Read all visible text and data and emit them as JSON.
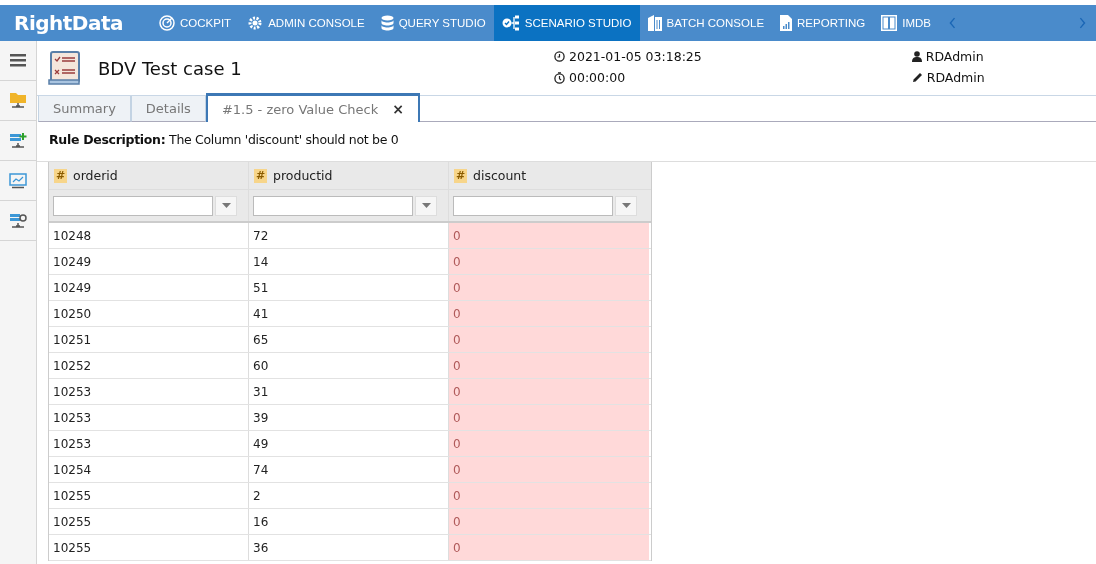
{
  "app": {
    "logo": "RightData"
  },
  "nav": [
    {
      "label": "COCKPIT",
      "selected": false
    },
    {
      "label": "ADMIN CONSOLE",
      "selected": false
    },
    {
      "label": "QUERY STUDIO",
      "selected": false
    },
    {
      "label": "SCENARIO STUDIO",
      "selected": true
    },
    {
      "label": "BATCH CONSOLE",
      "selected": false
    },
    {
      "label": "REPORTING",
      "selected": false
    },
    {
      "label": "IMDB",
      "selected": false
    }
  ],
  "header": {
    "title": "BDV Test case 1",
    "timestamp": "2021-01-05 03:18:25",
    "duration": "00:00:00",
    "owner": "RDAdmin",
    "editor": "RDAdmin"
  },
  "tabs": [
    {
      "label": "Summary",
      "selected": false
    },
    {
      "label": "Details",
      "selected": false
    },
    {
      "label": "#1.5 - zero Value Check",
      "selected": true,
      "close": "×"
    }
  ],
  "rule": {
    "label": "Rule Description:",
    "text": "The Column 'discount' should not be 0"
  },
  "table": {
    "columns": [
      {
        "name": "orderid",
        "type": "#",
        "flagged": false
      },
      {
        "name": "productid",
        "type": "#",
        "flagged": false
      },
      {
        "name": "discount",
        "type": "#",
        "flagged": true
      }
    ],
    "rows": [
      [
        "10248",
        "72",
        "0"
      ],
      [
        "10249",
        "14",
        "0"
      ],
      [
        "10249",
        "51",
        "0"
      ],
      [
        "10250",
        "41",
        "0"
      ],
      [
        "10251",
        "65",
        "0"
      ],
      [
        "10252",
        "60",
        "0"
      ],
      [
        "10253",
        "31",
        "0"
      ],
      [
        "10253",
        "39",
        "0"
      ],
      [
        "10253",
        "49",
        "0"
      ],
      [
        "10254",
        "74",
        "0"
      ],
      [
        "10255",
        "2",
        "0"
      ],
      [
        "10255",
        "16",
        "0"
      ],
      [
        "10255",
        "36",
        "0"
      ]
    ]
  }
}
